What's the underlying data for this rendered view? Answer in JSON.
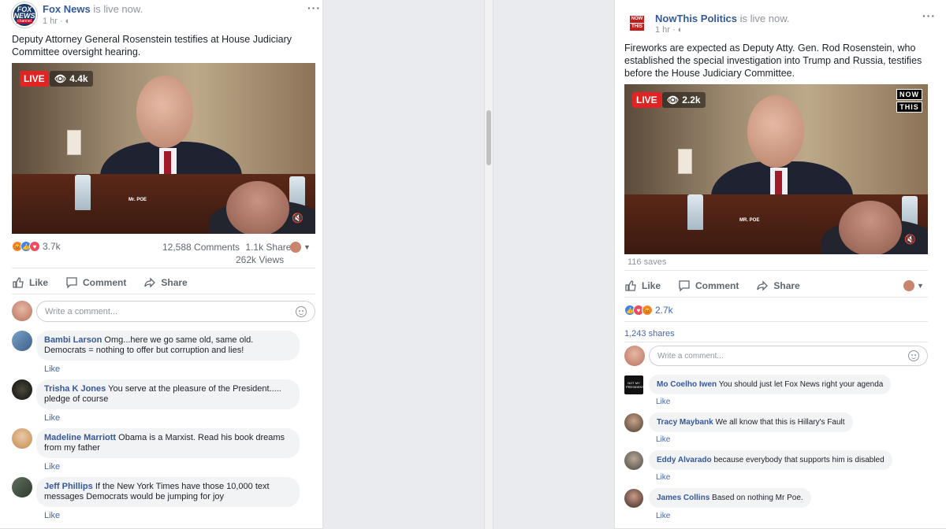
{
  "left_post": {
    "page_name": "Fox News",
    "status": "is live now.",
    "time": "1 hr",
    "logo": {
      "line1": "FOX",
      "line2": "NEWS",
      "line3": "channel"
    },
    "text": "Deputy Attorney General Rosenstein testifies at House Judiciary Committee oversight hearing.",
    "video": {
      "live_label": "LIVE",
      "viewers": "4.4k",
      "nameplate": "Mr. POE"
    },
    "reactions_count": "3.7k",
    "comments_count": "12,588 Comments",
    "shares_count": "1.1k Shares",
    "views_count": "262k Views",
    "actions": {
      "like": "Like",
      "comment": "Comment",
      "share": "Share"
    },
    "comment_placeholder": "Write a comment...",
    "comments": [
      {
        "name": "Bambi Larson",
        "text": "Omg...here we go same old, same old. Democrats = nothing to offer but corruption and lies!",
        "like": "Like"
      },
      {
        "name": "Trisha K Jones",
        "text": "You serve at the pleasure of the President..... pledge of course",
        "like": "Like"
      },
      {
        "name": "Madeline Marriott",
        "text": "Obama is a Marxist. Read his book dreams from my father",
        "like": "Like"
      },
      {
        "name": "Jeff Phillips",
        "text": "If the New York Times have those 10,000 text messages Democrats would be jumping for joy",
        "like": "Like"
      }
    ]
  },
  "right_post": {
    "page_name": "NowThis Politics",
    "status": "is live now.",
    "time": "1 hr",
    "logo": {
      "line1": "NOW",
      "line2": "THIS"
    },
    "text": "Fireworks are expected as Deputy Atty. Gen. Rod Rosenstein, who established the special investigation into Trump and Russia, testifies before the House Judiciary Committee.",
    "video": {
      "live_label": "LIVE",
      "viewers": "2.2k",
      "nameplate": "MR. POE",
      "watermark_top": "NOW",
      "watermark_bottom": "THIS"
    },
    "saves": "116 saves",
    "actions": {
      "like": "Like",
      "comment": "Comment",
      "share": "Share"
    },
    "reactions_count": "2.7k",
    "shares": "1,243 shares",
    "comment_placeholder": "Write a comment...",
    "comments": [
      {
        "name": "Mo Coelho Iwen",
        "text": "You should just let Fox News right your agenda",
        "like": "Like",
        "avatar_text": "NOT MY PRESIDENT"
      },
      {
        "name": "Tracy Maybank",
        "text": "We all know that this is Hillary's Fault",
        "like": "Like"
      },
      {
        "name": "Eddy Alvarado",
        "text": "because everybody that supports him is disabled",
        "like": "Like"
      },
      {
        "name": "James Collins",
        "text": "Based on nothing Mr Poe.",
        "like": "Like"
      }
    ]
  },
  "colors": {
    "link": "#365899",
    "live": "#e02424",
    "background": "#e9ebee"
  }
}
